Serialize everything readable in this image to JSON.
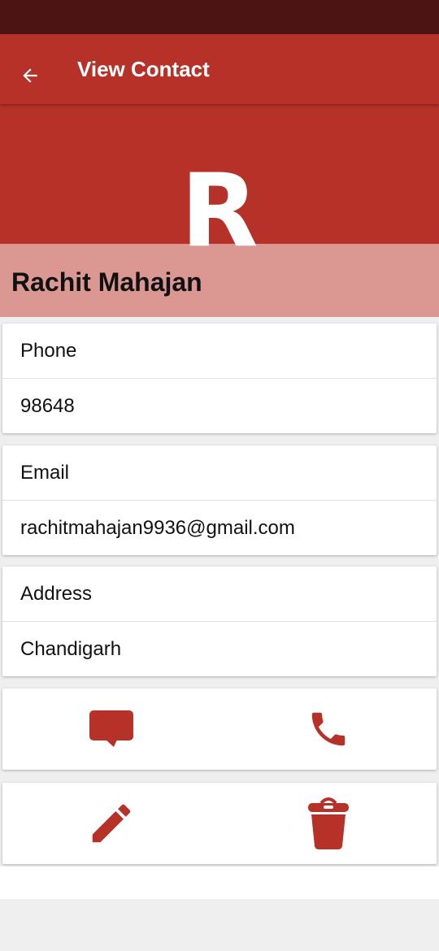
{
  "app_bar": {
    "title": "View Contact",
    "back_icon": "arrow-left-icon"
  },
  "contact": {
    "initial": "R",
    "name": "Rachit Mahajan"
  },
  "fields": {
    "phone": {
      "label": "Phone",
      "value": "98648"
    },
    "email": {
      "label": "Email",
      "value": "rachitmahajan9936@gmail.com"
    },
    "address": {
      "label": "Address",
      "value": "Chandigarh"
    }
  },
  "actions": [
    {
      "name": "message",
      "icon": "message-icon"
    },
    {
      "name": "call",
      "icon": "phone-icon"
    },
    {
      "name": "edit",
      "icon": "pencil-icon"
    },
    {
      "name": "delete",
      "icon": "trash-icon"
    }
  ],
  "colors": {
    "status_bar": "#4a1512",
    "primary": "#b63128",
    "name_band": "#db9893",
    "icon": "#b63128",
    "background": "#efefef"
  }
}
